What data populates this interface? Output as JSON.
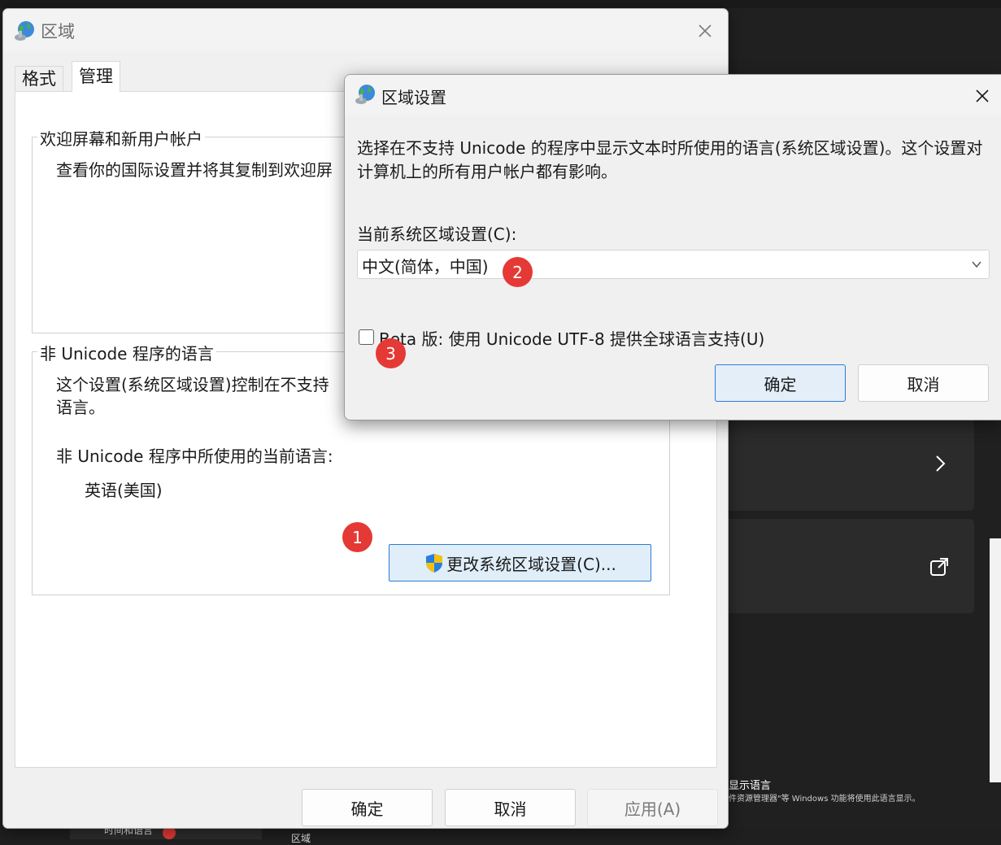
{
  "region_dialog": {
    "title": "区域",
    "tabs": [
      "格式",
      "管理"
    ],
    "welcome_group": {
      "title": "欢迎屏幕和新用户帐户",
      "text": "查看你的国际设置并将其复制到欢迎屏"
    },
    "non_unicode_group": {
      "title": "非 Unicode 程序的语言",
      "text_line1": "这个设置(系统区域设置)控制在不支持",
      "text_line2": "语言。",
      "current_label": "非 Unicode 程序中所使用的当前语言:",
      "current_value": "英语(美国)",
      "change_button": "更改系统区域设置(C)..."
    },
    "buttons": {
      "ok": "确定",
      "cancel": "取消",
      "apply": "应用(A)"
    }
  },
  "region_settings_dialog": {
    "title": "区域设置",
    "description": "选择在不支持 Unicode 的程序中显示文本时所使用的语言(系统区域设置)。这个设置对计算机上的所有用户帐户都有影响。",
    "current_locale_label": "当前系统区域设置(C):",
    "current_locale_value": "中文(简体，中国)",
    "beta_checkbox": {
      "label": "Beta 版: 使用 Unicode UTF-8 提供全球语言支持(U)",
      "checked": false
    },
    "buttons": {
      "ok": "确定",
      "cancel": "取消"
    }
  },
  "markers": [
    "1",
    "2",
    "3"
  ],
  "background": {
    "language_title": "显示语言",
    "language_sub": "件资源管理器\"等 Windows 功能将使用此语言显示。",
    "bottom_tab_label": "时间和语言",
    "bottom_label2": "区域"
  },
  "colors": {
    "marker": "#e53935",
    "accent_border": "#2c7bd6",
    "dark_bg": "#202020"
  }
}
